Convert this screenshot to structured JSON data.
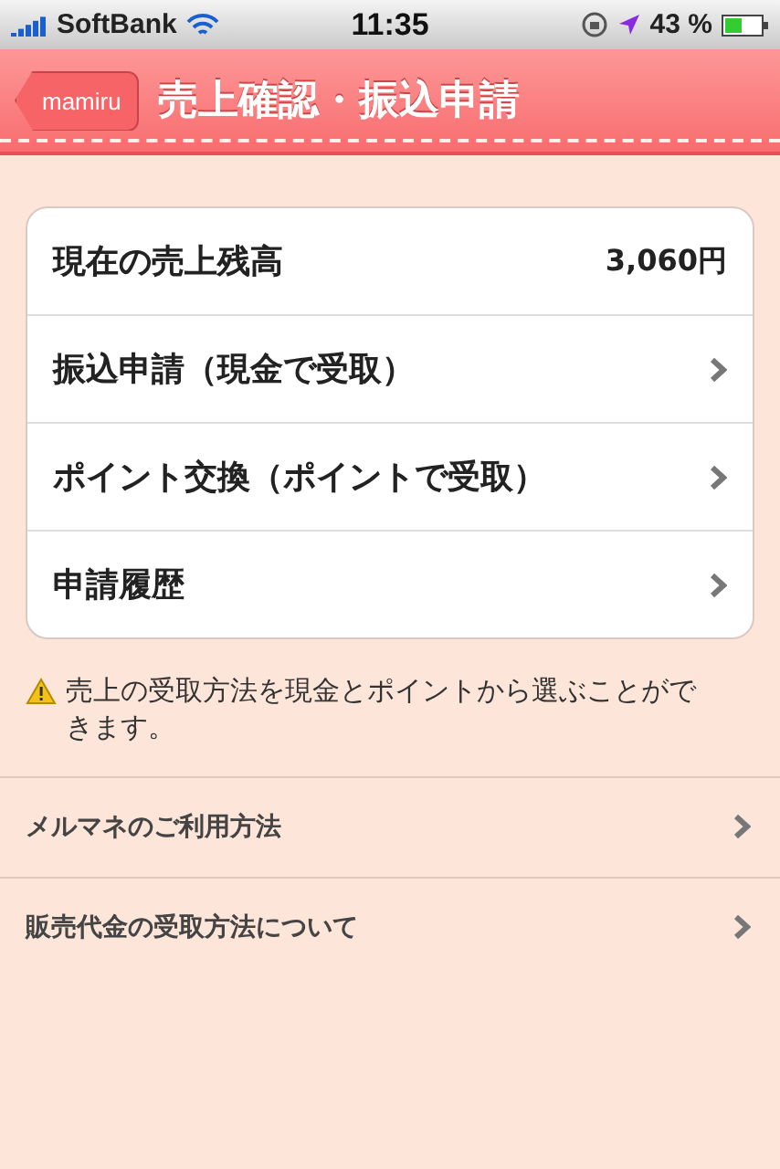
{
  "status_bar": {
    "carrier": "SoftBank",
    "time": "11:35",
    "battery": "43 %"
  },
  "nav_bar": {
    "back": "mamiru",
    "title": "売上確認・振込申請"
  },
  "menu_card": [
    {
      "kind": "value",
      "label": "現在の売上残高",
      "value": "3,060円"
    },
    {
      "kind": "link",
      "label": "振込申請（現金で受取）"
    },
    {
      "kind": "link",
      "label": "ポイント交換（ポイントで受取）"
    },
    {
      "kind": "link",
      "label": "申請履歴"
    }
  ],
  "notice": "売上の受取方法を現金とポイントから選ぶことができます。",
  "help_links": [
    {
      "label": "メルマネのご利用方法"
    },
    {
      "label": "販売代金の受取方法について"
    }
  ]
}
